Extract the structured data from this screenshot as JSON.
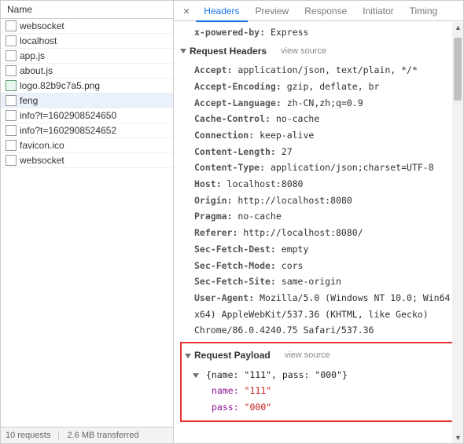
{
  "leftPanel": {
    "header": "Name",
    "items": [
      {
        "name": "websocket",
        "icon": "doc",
        "selected": false
      },
      {
        "name": "localhost",
        "icon": "doc",
        "selected": false
      },
      {
        "name": "app.js",
        "icon": "doc",
        "selected": false
      },
      {
        "name": "about.js",
        "icon": "doc",
        "selected": false
      },
      {
        "name": "logo.82b9c7a5.png",
        "icon": "img",
        "selected": false
      },
      {
        "name": "feng",
        "icon": "doc",
        "selected": true
      },
      {
        "name": "info?t=1602908524650",
        "icon": "doc",
        "selected": false
      },
      {
        "name": "info?t=1602908524652",
        "icon": "doc",
        "selected": false
      },
      {
        "name": "favicon.ico",
        "icon": "doc",
        "selected": false
      },
      {
        "name": "websocket",
        "icon": "doc",
        "selected": false
      }
    ],
    "status": {
      "requests": "10 requests",
      "transferred": "2.6 MB transferred"
    }
  },
  "tabs": [
    "Headers",
    "Preview",
    "Response",
    "Initiator",
    "Timing"
  ],
  "activeTab": 0,
  "xPoweredBy": {
    "k": "x-powered-by:",
    "v": "Express"
  },
  "requestHeaders": {
    "title": "Request Headers",
    "viewSource": "view source",
    "pairs": [
      {
        "k": "Accept:",
        "v": "application/json, text/plain, */*"
      },
      {
        "k": "Accept-Encoding:",
        "v": "gzip, deflate, br"
      },
      {
        "k": "Accept-Language:",
        "v": "zh-CN,zh;q=0.9"
      },
      {
        "k": "Cache-Control:",
        "v": "no-cache"
      },
      {
        "k": "Connection:",
        "v": "keep-alive"
      },
      {
        "k": "Content-Length:",
        "v": "27"
      },
      {
        "k": "Content-Type:",
        "v": "application/json;charset=UTF-8"
      },
      {
        "k": "Host:",
        "v": "localhost:8080"
      },
      {
        "k": "Origin:",
        "v": "http://localhost:8080"
      },
      {
        "k": "Pragma:",
        "v": "no-cache"
      },
      {
        "k": "Referer:",
        "v": "http://localhost:8080/"
      },
      {
        "k": "Sec-Fetch-Dest:",
        "v": "empty"
      },
      {
        "k": "Sec-Fetch-Mode:",
        "v": "cors"
      },
      {
        "k": "Sec-Fetch-Site:",
        "v": "same-origin"
      },
      {
        "k": "User-Agent:",
        "v": "Mozilla/5.0 (Windows NT 10.0; Win64; x64) AppleWebKit/537.36 (KHTML, like Gecko) Chrome/86.0.4240.75 Safari/537.36"
      }
    ]
  },
  "requestPayload": {
    "title": "Request Payload",
    "viewSource": "view source",
    "objectLine": "{name: \"111\", pass: \"000\"}",
    "pairs": [
      {
        "k": "name:",
        "v": "\"111\""
      },
      {
        "k": "pass:",
        "v": "\"000\""
      }
    ]
  }
}
